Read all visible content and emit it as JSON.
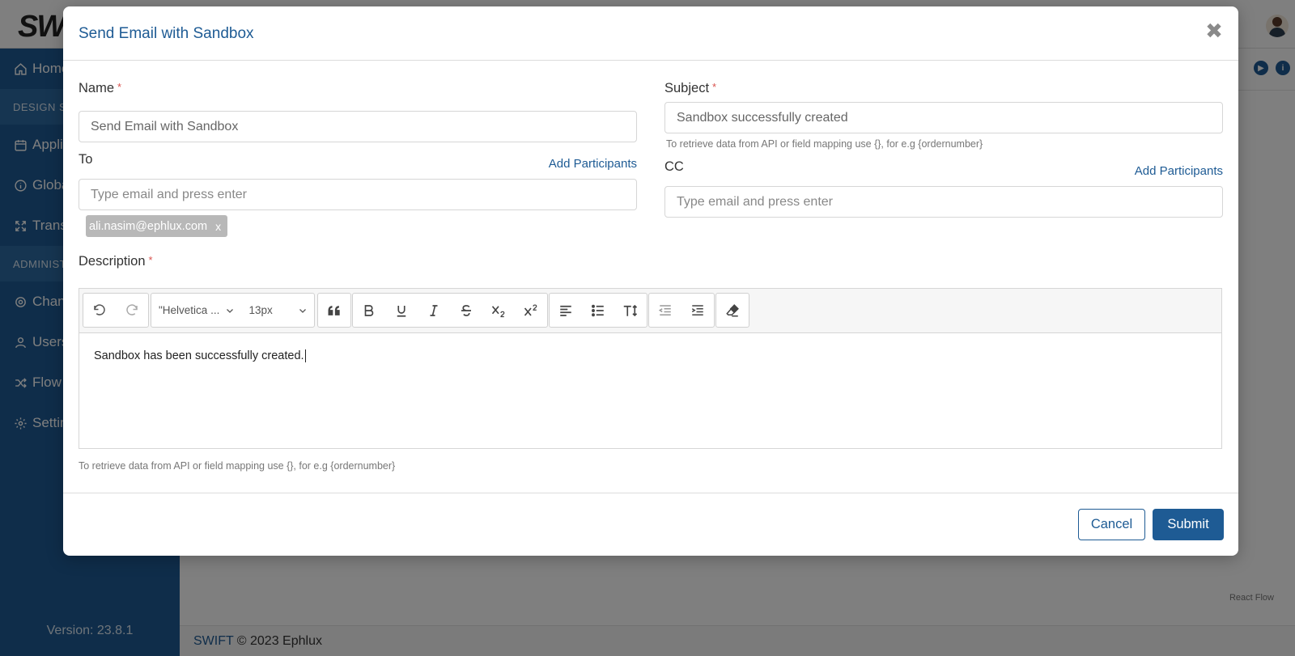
{
  "app": {
    "logo_text": "SWIFT",
    "version": "Version: 23.8.1",
    "footer_brand": "SWIFT",
    "footer_text": "© 2023 Ephlux",
    "react_flow": "React Flow"
  },
  "sidebar": {
    "items": [
      {
        "label": "Home",
        "icon": "home-icon"
      },
      {
        "section": "DESIGN ST"
      },
      {
        "label": "Appli",
        "icon": "calendar-icon"
      },
      {
        "label": "Globa",
        "icon": "info-icon"
      },
      {
        "label": "Trans",
        "icon": "expand-icon"
      },
      {
        "section": "ADMINIST"
      },
      {
        "label": "Chan",
        "icon": "cog-icon"
      },
      {
        "label": "Users",
        "icon": "user-icon"
      },
      {
        "label": "Flow",
        "icon": "shuffle-icon"
      },
      {
        "label": "Settin",
        "icon": "gear-icon"
      }
    ]
  },
  "modal": {
    "title": "Send Email with Sandbox",
    "close_glyph": "✖",
    "name": {
      "label": "Name",
      "value": "Send Email with Sandbox"
    },
    "subject": {
      "label": "Subject",
      "value": "Sandbox successfully created",
      "hint": "To retrieve data from API or field mapping use {}, for e.g {ordernumber}"
    },
    "to": {
      "label": "To",
      "add_link": "Add Participants",
      "placeholder": "Type email and press enter",
      "chips": [
        "ali.nasim@ephlux.com"
      ],
      "chip_remove": "x"
    },
    "cc": {
      "label": "CC",
      "add_link": "Add Participants",
      "placeholder": "Type email and press enter"
    },
    "description": {
      "label": "Description",
      "font_family": "\"Helvetica ...",
      "font_size": "13px",
      "content": "Sandbox has been successfully created.",
      "hint": "To retrieve data from API or field mapping use {}, for e.g {ordernumber}"
    },
    "required_marker": "*",
    "buttons": {
      "cancel": "Cancel",
      "submit": "Submit"
    }
  },
  "colors": {
    "primary": "#1e5b94",
    "required": "#d9534f"
  }
}
